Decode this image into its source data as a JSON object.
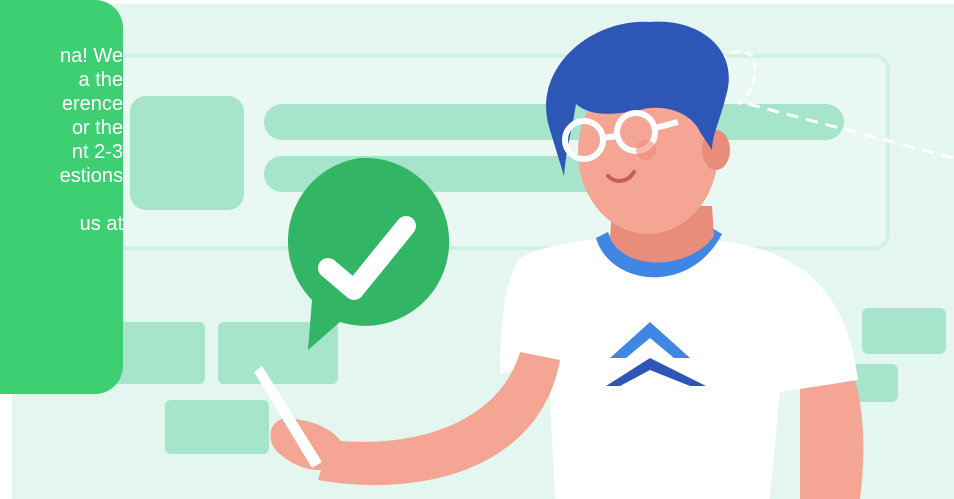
{
  "chat": {
    "lines": [
      "na! We",
      "a the",
      "erence",
      "or the",
      "nt 2-3",
      "estions",
      "",
      "us at"
    ]
  },
  "colors": {
    "panel_bg": "#e3f6ef",
    "skeleton": "#a6e4cc",
    "check_green": "#32b565",
    "shirt": "#ffffff",
    "hair": "#2e56b7",
    "logo": "#3f86e5",
    "chat_bubble": "#3fcf73"
  },
  "icons": [
    "checkmark-speech-bubble-icon",
    "brand-logo-icon",
    "person-illustration",
    "phone-icon",
    "glasses-icon"
  ]
}
